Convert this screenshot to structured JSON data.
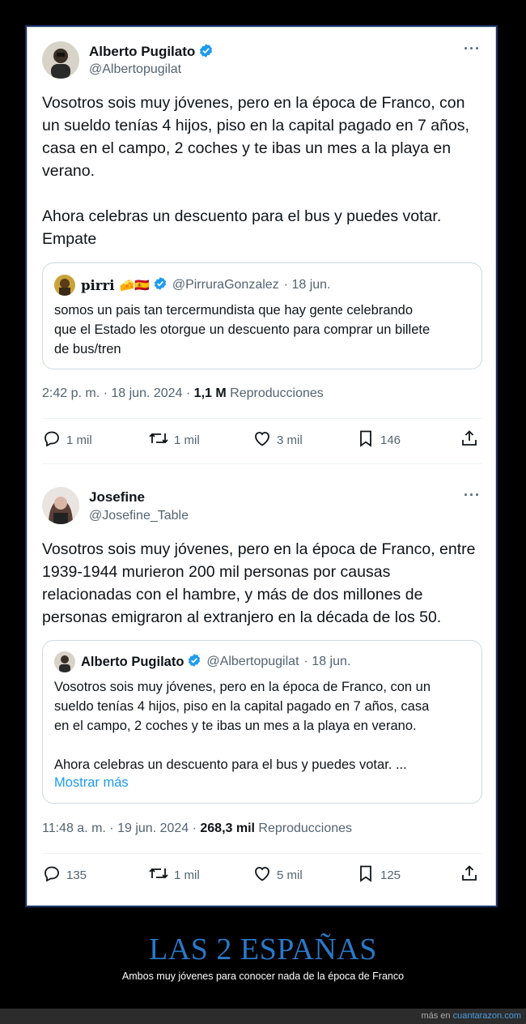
{
  "tweets": [
    {
      "name": "Alberto Pugilato",
      "handle": "@Albertopugilat",
      "text": "Vosotros sois muy jóvenes, pero en la época de Franco, con\nun sueldo tenías 4 hijos, piso en la capital pagado en 7 años,\ncasa en el campo, 2 coches y te ibas un mes a la playa en\nverano.\n\nAhora celebras un descuento para el bus y puedes votar.\nEmpate",
      "quote": {
        "name": "pirri",
        "emoji": "🧀🇪🇸",
        "handle": "@PirruraGonzalez",
        "date": "· 18 jun.",
        "text": "somos un pais tan tercermundista que hay gente celebrando\nque el Estado les otorgue un descuento para comprar un billete\nde bus/tren"
      },
      "time": "2:42 p. m. · 18 jun. 2024 · ",
      "views": "1,1 M",
      "views_label": " Reproducciones",
      "replies": "1 mil",
      "retweets": "1 mil",
      "likes": "3 mil",
      "bookmarks": "146"
    },
    {
      "name": "Josefine",
      "handle": "@Josefine_Table",
      "text": "Vosotros sois muy jóvenes, pero en la época de Franco, entre\n1939-1944 murieron 200 mil personas por causas\nrelacionadas con el hambre, y más de dos millones de\npersonas emigraron al extranjero en la década de los 50.",
      "quote": {
        "name": "Alberto Pugilato",
        "handle": "@Albertopugilat",
        "date": "· 18 jun.",
        "text": "Vosotros sois muy jóvenes, pero en la época de Franco, con un\nsueldo tenías 4 hijos, piso en la capital pagado en 7 años, casa\nen el campo, 2 coches y te ibas un mes a la playa en verano.\n\nAhora celebras un descuento para el bus y puedes votar. ...",
        "show_more": "Mostrar más"
      },
      "time": "11:48 a. m. · 19 jun. 2024 · ",
      "views": "268,3 mil",
      "views_label": " Reproducciones",
      "replies": "135",
      "retweets": "1 mil",
      "likes": "5 mil",
      "bookmarks": "125"
    }
  ],
  "more_glyph": "···",
  "headline": "LAS 2 ESPAÑAS",
  "subline": "Ambos muy jóvenes para conocer nada de la época de Franco",
  "footer": {
    "prefix": "más en ",
    "site": "cuantarazon.com"
  },
  "colors": {
    "accent": "#1d9bf0",
    "headline": "#2a78c7",
    "text": "#0f1419",
    "muted": "#536471"
  }
}
